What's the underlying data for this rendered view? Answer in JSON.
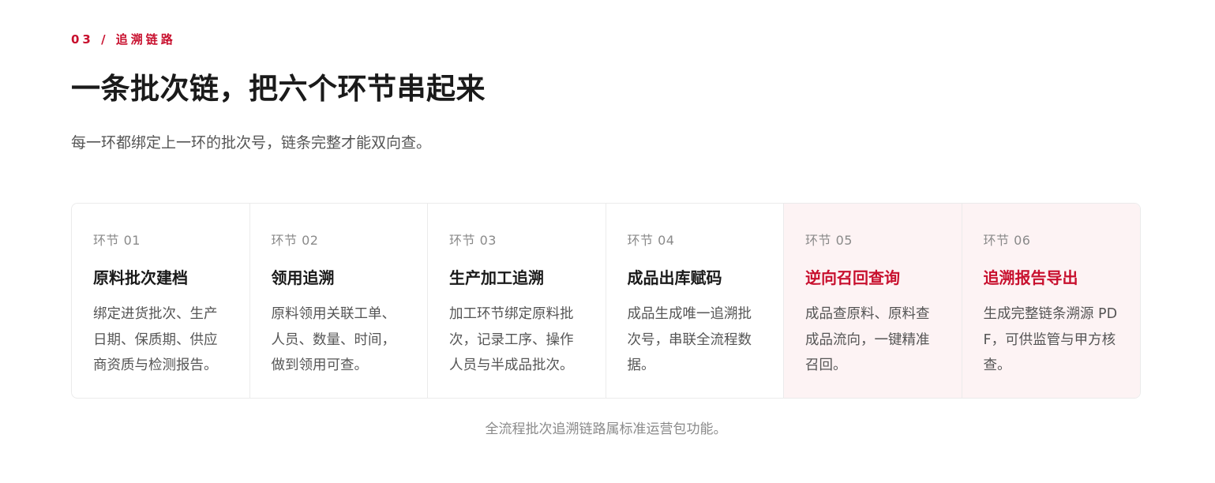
{
  "section": {
    "eyebrow": "03 / 追溯链路",
    "headline": "一条批次链，把六个环节串起来",
    "subhead": "每一环都绑定上一环的批次号，链条完整才能双向查。",
    "footnote": "全流程批次追溯链路属标准运营包功能。"
  },
  "colors": {
    "accent": "#c8102e",
    "accent_bg": "#fdf3f4",
    "text": "#1a1a1a",
    "muted": "#8a8a8a",
    "border": "#ebebeb"
  },
  "steps": [
    {
      "num": "环节 01",
      "title": "原料批次建档",
      "desc": "绑定进货批次、生产日期、保质期、供应商资质与检测报告。",
      "accent": false
    },
    {
      "num": "环节 02",
      "title": "领用追溯",
      "desc": "原料领用关联工单、人员、数量、时间，做到领用可查。",
      "accent": false
    },
    {
      "num": "环节 03",
      "title": "生产加工追溯",
      "desc": "加工环节绑定原料批次，记录工序、操作人员与半成品批次。",
      "accent": false
    },
    {
      "num": "环节 04",
      "title": "成品出库赋码",
      "desc": "成品生成唯一追溯批次号，串联全流程数据。",
      "accent": false
    },
    {
      "num": "环节 05",
      "title": "逆向召回查询",
      "desc": "成品查原料、原料查成品流向，一键精准召回。",
      "accent": true
    },
    {
      "num": "环节 06",
      "title": "追溯报告导出",
      "desc": "生成完整链条溯源 PDF，可供监管与甲方核查。",
      "accent": true
    }
  ]
}
